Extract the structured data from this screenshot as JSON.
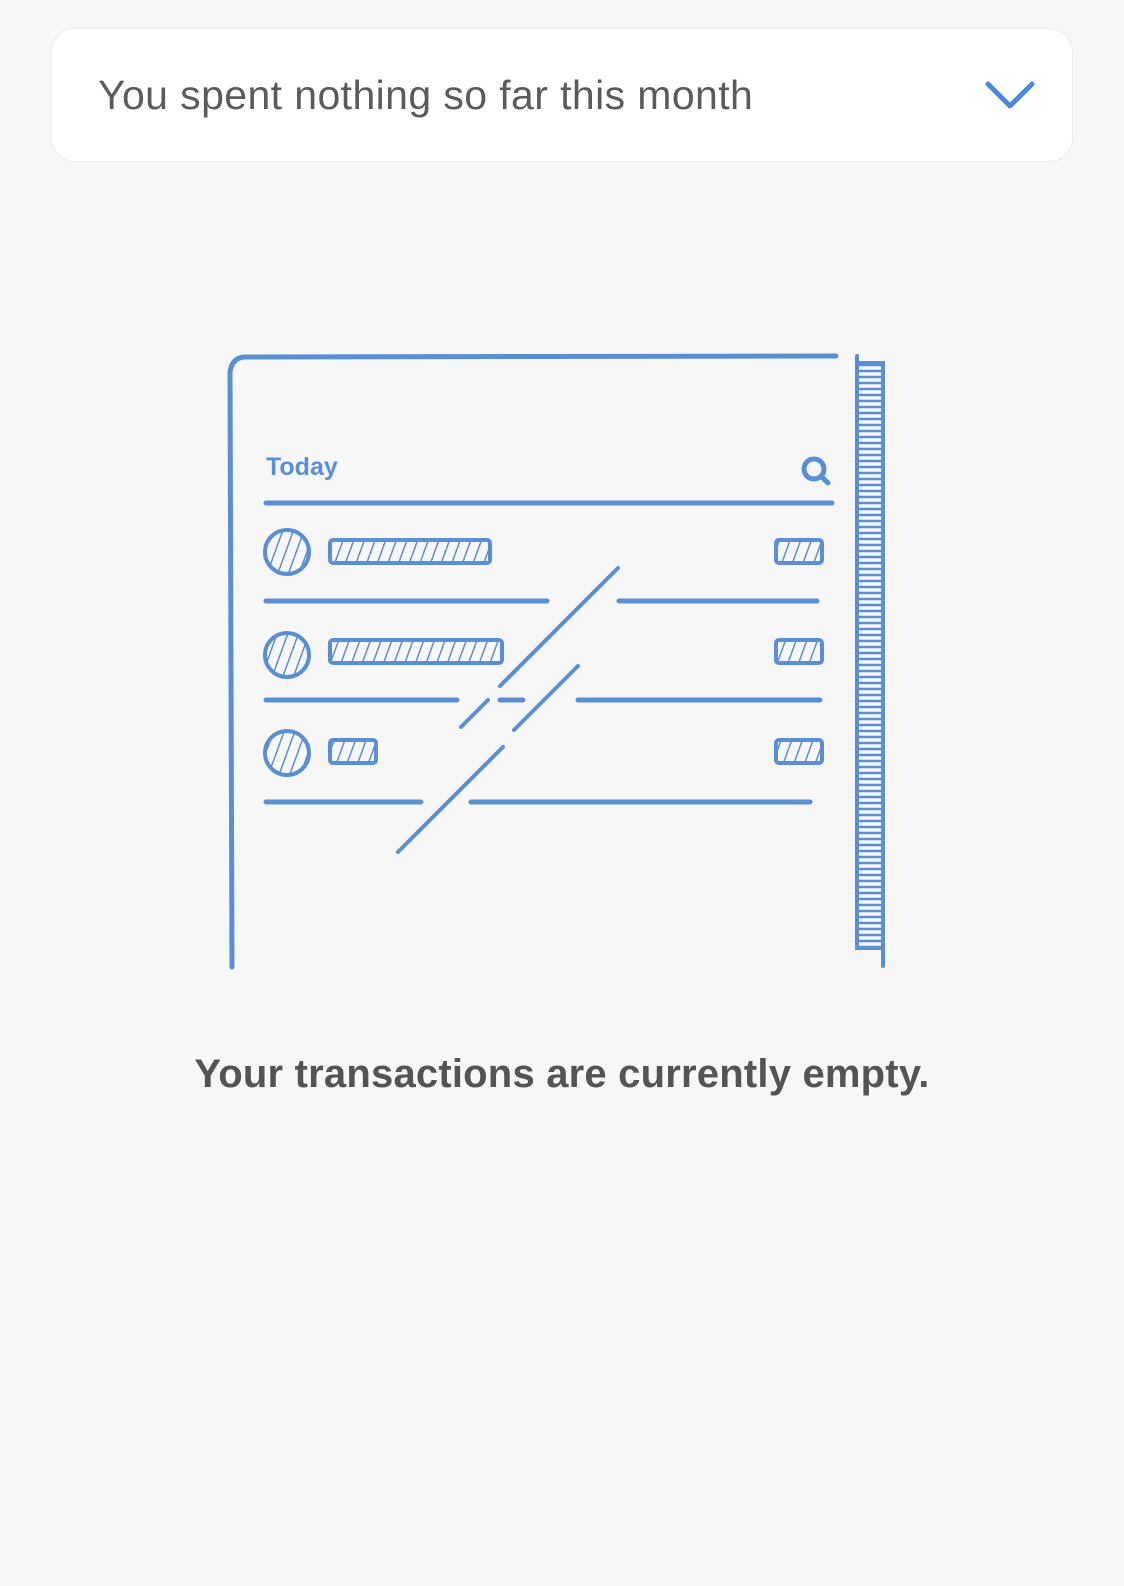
{
  "summary": {
    "text": "You spent nothing so far this month",
    "toggle_icon": "chevron-down-icon"
  },
  "illustration": {
    "header_label": "Today",
    "search_icon": "search-icon"
  },
  "empty_state": {
    "message": "Your transactions are currently empty."
  },
  "colors": {
    "accent": "#4a8ad8",
    "illustration": "#5a8fd4",
    "text_primary": "#545454",
    "background": "#f7f7f7"
  }
}
